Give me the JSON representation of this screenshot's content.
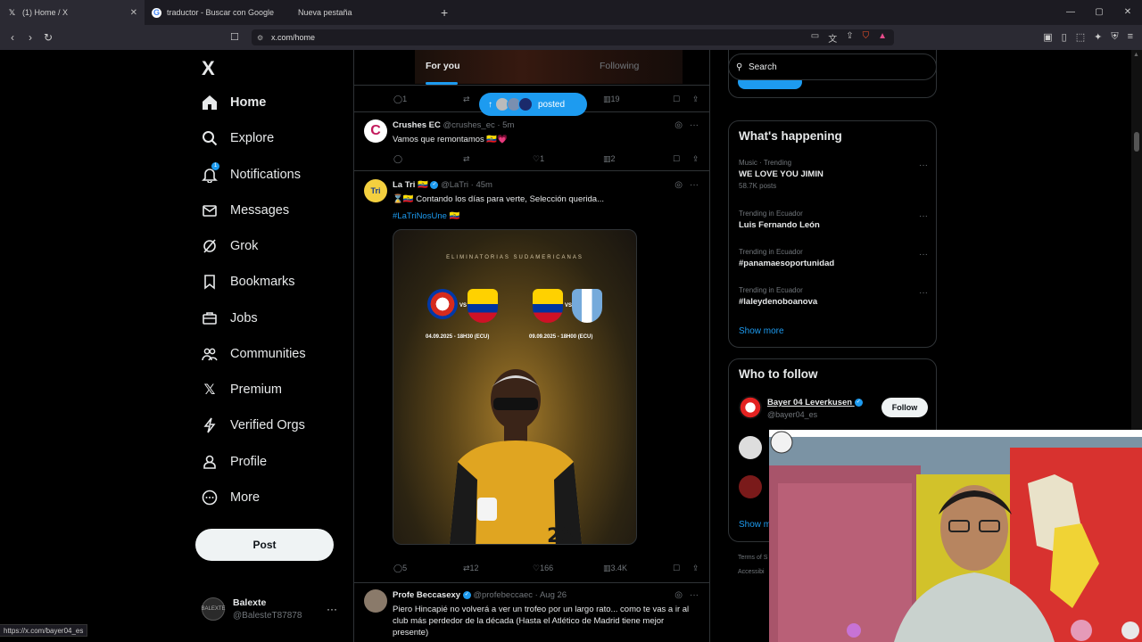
{
  "browser": {
    "tabs": [
      {
        "title": "(1) Home / X",
        "icon": "x-icon",
        "active": true
      },
      {
        "title": "traductor - Buscar con Google",
        "icon": "google-icon",
        "active": false
      },
      {
        "title": "Nueva pestaña",
        "icon": "none",
        "active": false
      }
    ],
    "new_tab": "+",
    "url": "x.com/home",
    "status_url": "https://x.com/bayer04_es",
    "window_controls": {
      "minimize": "—",
      "maximize": "▢",
      "close": "✕"
    }
  },
  "nav": {
    "logo": "X",
    "items": [
      {
        "label": "Home",
        "icon": "home-icon"
      },
      {
        "label": "Explore",
        "icon": "search-icon"
      },
      {
        "label": "Notifications",
        "icon": "bell-icon",
        "badge": "1"
      },
      {
        "label": "Messages",
        "icon": "mail-icon"
      },
      {
        "label": "Grok",
        "icon": "grok-icon"
      },
      {
        "label": "Bookmarks",
        "icon": "bookmark-icon"
      },
      {
        "label": "Jobs",
        "icon": "briefcase-icon"
      },
      {
        "label": "Communities",
        "icon": "people-icon"
      },
      {
        "label": "Premium",
        "icon": "x-icon"
      },
      {
        "label": "Verified Orgs",
        "icon": "lightning-icon"
      },
      {
        "label": "Profile",
        "icon": "person-icon"
      },
      {
        "label": "More",
        "icon": "more-circle-icon"
      }
    ],
    "post_button": "Post",
    "account": {
      "name": "Balexte",
      "handle": "@BalesteT87878",
      "avatar_text": "BALEXTE"
    }
  },
  "timeline": {
    "tabs": {
      "for_you": "For you",
      "following": "Following"
    },
    "prev_tweet_actions": {
      "replies": "1",
      "views": "19"
    },
    "posted_pill": "posted",
    "tweets": [
      {
        "name": "Crushes EC",
        "handle": "@crushes_ec",
        "time": "· 5m",
        "text": "Vamos que remontamos 🇪🇨💗",
        "replies": "",
        "retweets": "",
        "likes": "1",
        "views": "2"
      },
      {
        "name": "La Tri 🇪🇨",
        "handle": "@LaTri",
        "time": "· 45m",
        "text": "⌛🇪🇨 Contando los días para verte, Selección querida...",
        "hashtag": "#LaTriNosUne 🇪🇨",
        "media": {
          "title": "ELIMINATORIAS SUDAMERICANAS",
          "vs": "VS",
          "date1": "04.09.2025 - 18H30 (ECU)",
          "date2": "09.09.2025 - 18H00 (ECU)"
        },
        "replies": "5",
        "retweets": "12",
        "likes": "166",
        "views": "3.4K"
      },
      {
        "name": "Profe Beccasexy",
        "handle": "@profebeccaec",
        "time": "· Aug 26",
        "text": "Piero Hincapié no volverá a ver un trofeo por un largo rato... como te vas a ir al club más perdedor de la década (Hasta el Atlético de Madrid tiene mejor presente)"
      }
    ]
  },
  "sidebar": {
    "search_placeholder": "Search",
    "happening": {
      "title": "What's happening",
      "trends": [
        {
          "context": "Music · Trending",
          "title": "WE LOVE YOU JIMIN",
          "count": "58.7K posts"
        },
        {
          "context": "Trending in Ecuador",
          "title": "Luis Fernando León",
          "count": ""
        },
        {
          "context": "Trending in Ecuador",
          "title": "#panamaesoportunidad",
          "count": ""
        },
        {
          "context": "Trending in Ecuador",
          "title": "#laleydenoboanova",
          "count": ""
        }
      ],
      "show_more": "Show more"
    },
    "who_to_follow": {
      "title": "Who to follow",
      "accounts": [
        {
          "name": "Bayer 04 Leverkusen",
          "handle": "@bayer04_es",
          "button": "Follow"
        }
      ],
      "show_more": "Show m"
    },
    "footer": {
      "terms": "Terms of S",
      "access": "Accessibi"
    }
  },
  "colors": {
    "accent": "#1d9bf0",
    "background": "#000000",
    "border": "#2f3336",
    "muted": "#71767b",
    "text": "#e7e9ea"
  }
}
